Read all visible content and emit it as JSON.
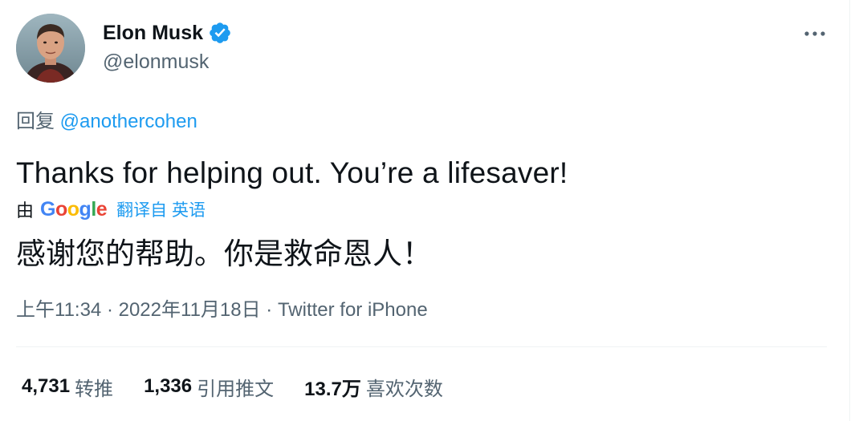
{
  "author": {
    "name": "Elon Musk",
    "handle": "@elonmusk",
    "verified": true
  },
  "reply_to": {
    "prefix": "回复",
    "mention": "@anothercohen"
  },
  "tweet": {
    "text": "Thanks for helping out. You’re a lifesaver!"
  },
  "translation": {
    "by_label": "由",
    "provider": "Google",
    "link_label": "翻译自 英语",
    "text": "感谢您的帮助。你是救命恩人！"
  },
  "meta": {
    "time": "上午11:34",
    "separator1": " · ",
    "date": "2022年11月18日",
    "separator2": " · ",
    "source": "Twitter for iPhone"
  },
  "stats": [
    {
      "count": "4,731",
      "label": "转推"
    },
    {
      "count": "1,336",
      "label": "引用推文"
    },
    {
      "count": "13.7万",
      "label": "喜欢次数"
    }
  ],
  "colors": {
    "accent": "#1d9bf0",
    "secondary_text": "#536471",
    "primary_text": "#0f1419",
    "divider": "#eff3f4"
  }
}
